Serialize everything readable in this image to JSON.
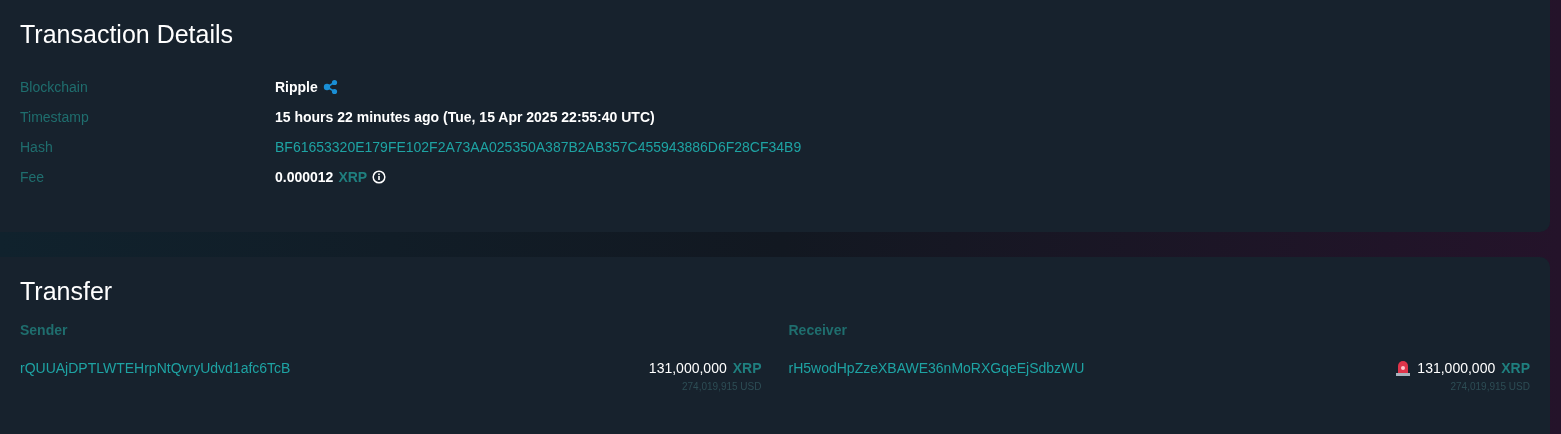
{
  "transaction_details": {
    "title": "Transaction Details",
    "rows": [
      {
        "label": "Blockchain",
        "kind": "chain",
        "value": "Ripple"
      },
      {
        "label": "Timestamp",
        "kind": "text",
        "value": "15 hours 22 minutes ago (Tue, 15 Apr 2025 22:55:40 UTC)"
      },
      {
        "label": "Hash",
        "kind": "link",
        "value": "BF61653320E179FE102F2A73AA025350A387B2AB357C455943886D6F28CF34B9"
      },
      {
        "label": "Fee",
        "kind": "amount",
        "value": "0.000012",
        "unit": "XRP"
      }
    ]
  },
  "transfer": {
    "title": "Transfer",
    "parties": [
      {
        "label": "Sender",
        "address": "rQUUAjDPTLWTEHrpNtQvryUdvd1afc6TcB",
        "amount": "131,000,000",
        "unit": "XRP",
        "usd": "274,019,915 USD",
        "alert": false
      },
      {
        "label": "Receiver",
        "address": "rH5wodHpZzeXBAWE36nMoRXGqeEjSdbzWU",
        "amount": "131,000,000",
        "unit": "XRP",
        "usd": "274,019,915 USD",
        "alert": true
      }
    ]
  }
}
